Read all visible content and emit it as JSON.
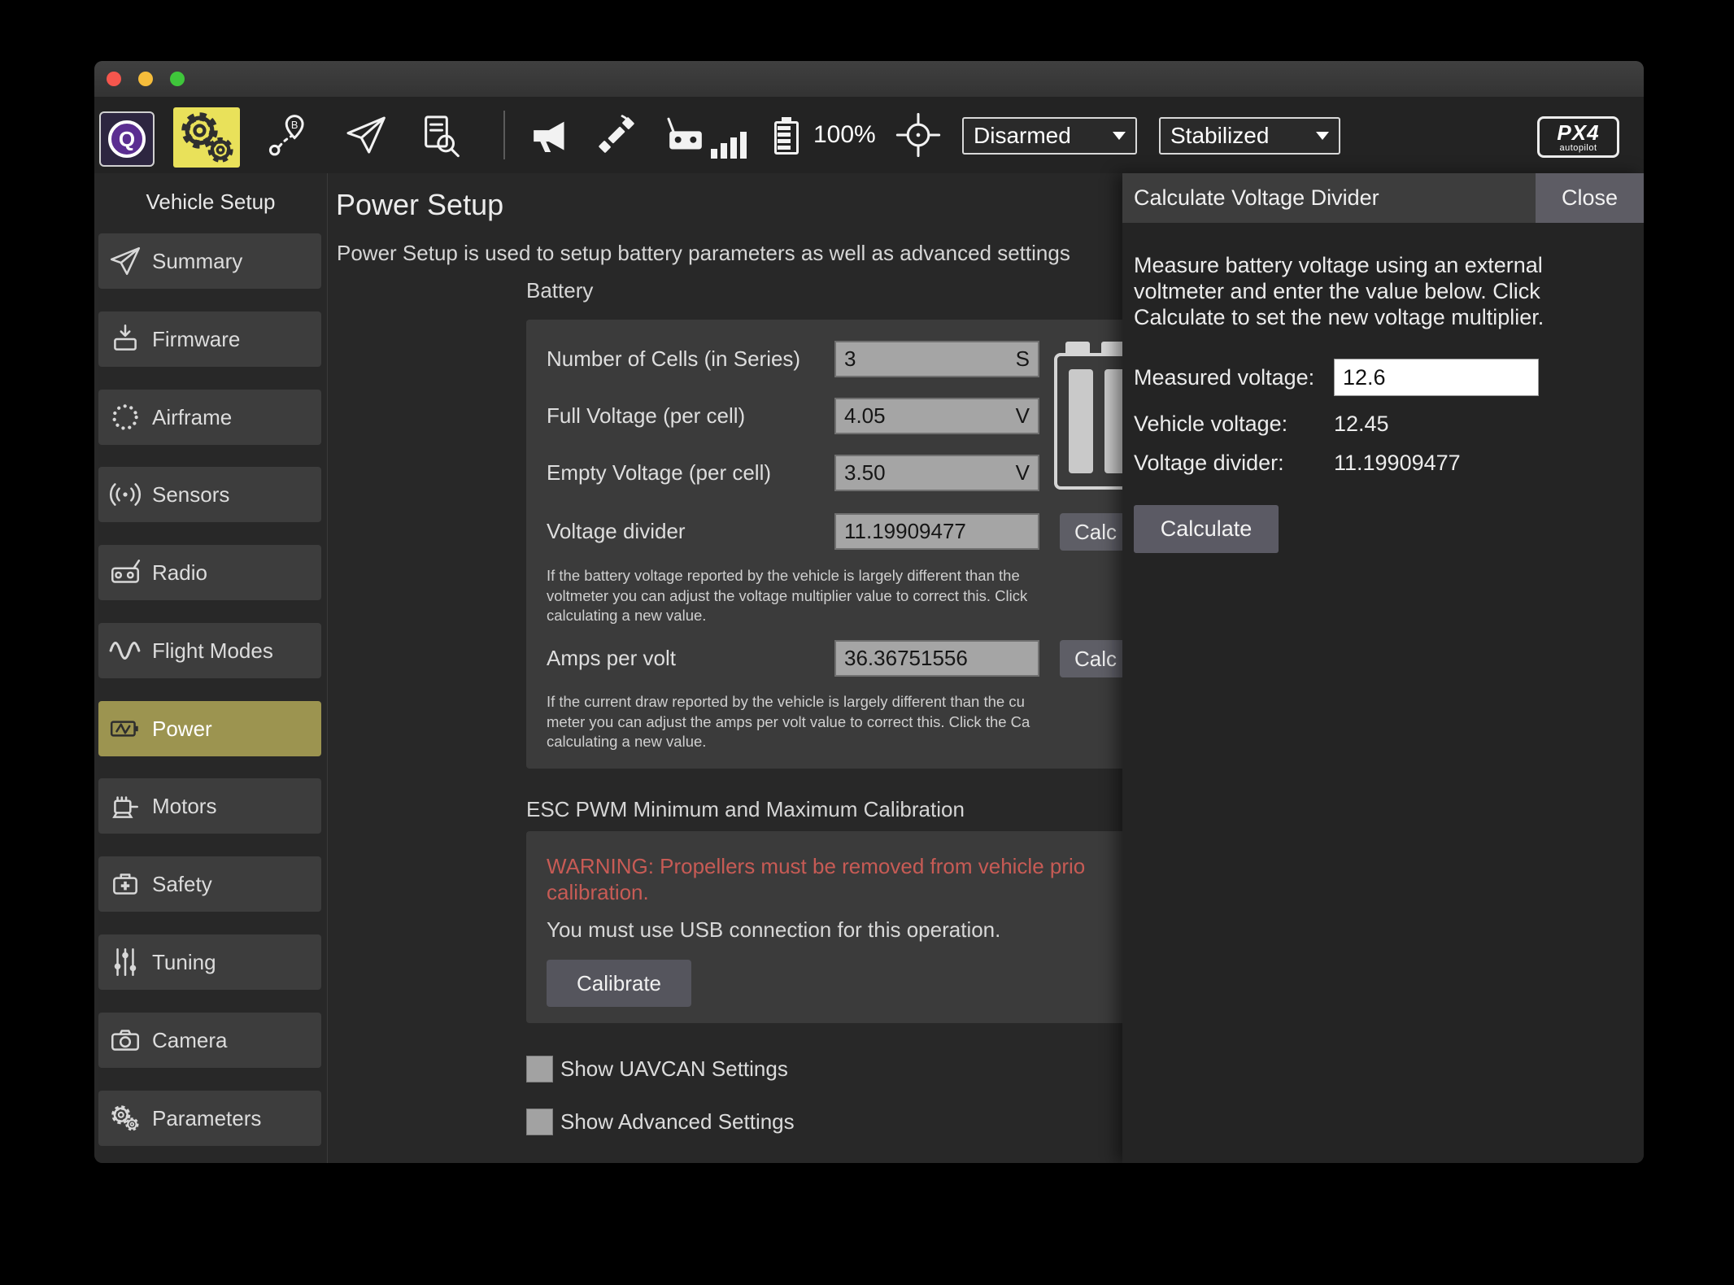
{
  "colors": {
    "accent_yellow": "#e9e15a",
    "active_sidebar_item": "#9c9450",
    "warning_red": "#c75b55",
    "logo_purple": "#5b2e91",
    "panel_gray": "#3b3b3b"
  },
  "toolbar": {
    "q_label": "Q",
    "battery_pct": "100%",
    "arm_state": "Disarmed",
    "flight_mode": "Stabilized",
    "logo_line1": "PX4",
    "logo_line2": "autopilot"
  },
  "sidebar": {
    "title": "Vehicle Setup",
    "items": [
      {
        "label": "Summary"
      },
      {
        "label": "Firmware"
      },
      {
        "label": "Airframe"
      },
      {
        "label": "Sensors"
      },
      {
        "label": "Radio"
      },
      {
        "label": "Flight Modes"
      },
      {
        "label": "Power"
      },
      {
        "label": "Motors"
      },
      {
        "label": "Safety"
      },
      {
        "label": "Tuning"
      },
      {
        "label": "Camera"
      },
      {
        "label": "Parameters"
      }
    ]
  },
  "main": {
    "title": "Power Setup",
    "subtitle": "Power Setup is used to setup battery parameters as well as advanced settings",
    "battery": {
      "section_label": "Battery",
      "rows": [
        {
          "label": "Number of Cells (in Series)",
          "value": "3",
          "suffix": "S"
        },
        {
          "label": "Full Voltage (per cell)",
          "value": "4.05",
          "suffix": "V"
        },
        {
          "label": "Empty Voltage (per cell)",
          "value": "3.50",
          "suffix": "V"
        },
        {
          "label": "Voltage divider",
          "value": "11.19909477",
          "suffix": ""
        }
      ],
      "calc_label": "Calc",
      "voltage_help": [
        "If the battery voltage reported by the vehicle is largely different than the",
        "voltmeter you can adjust the voltage multiplier value to correct this. Click",
        "calculating a new value."
      ],
      "amps_label": "Amps per volt",
      "amps_value": "36.36751556",
      "amps_help": [
        "If the current draw reported by the vehicle is largely different than the cu",
        "meter you can adjust the amps per volt value to correct this. Click the Ca",
        "calculating a new value."
      ]
    },
    "esc": {
      "title": "ESC PWM Minimum and Maximum Calibration",
      "warning_line1": "WARNING: Propellers must be removed from vehicle prio",
      "warning_line2": "calibration.",
      "note": "You must use USB connection for this operation.",
      "calibrate_label": "Calibrate"
    },
    "checkboxes": [
      {
        "label": "Show UAVCAN Settings",
        "checked": false
      },
      {
        "label": "Show Advanced Settings",
        "checked": false
      }
    ]
  },
  "dialog": {
    "title": "Calculate Voltage Divider",
    "close_label": "Close",
    "body_lines": [
      "Measure battery voltage using an external",
      "voltmeter and enter the value below. Click",
      "Calculate to set the new voltage multiplier."
    ],
    "measured_label": "Measured voltage:",
    "measured_value": "12.6",
    "vehicle_label": "Vehicle voltage:",
    "vehicle_value": "12.45",
    "divider_label": "Voltage divider:",
    "divider_value": "11.19909477",
    "calculate_label": "Calculate"
  }
}
